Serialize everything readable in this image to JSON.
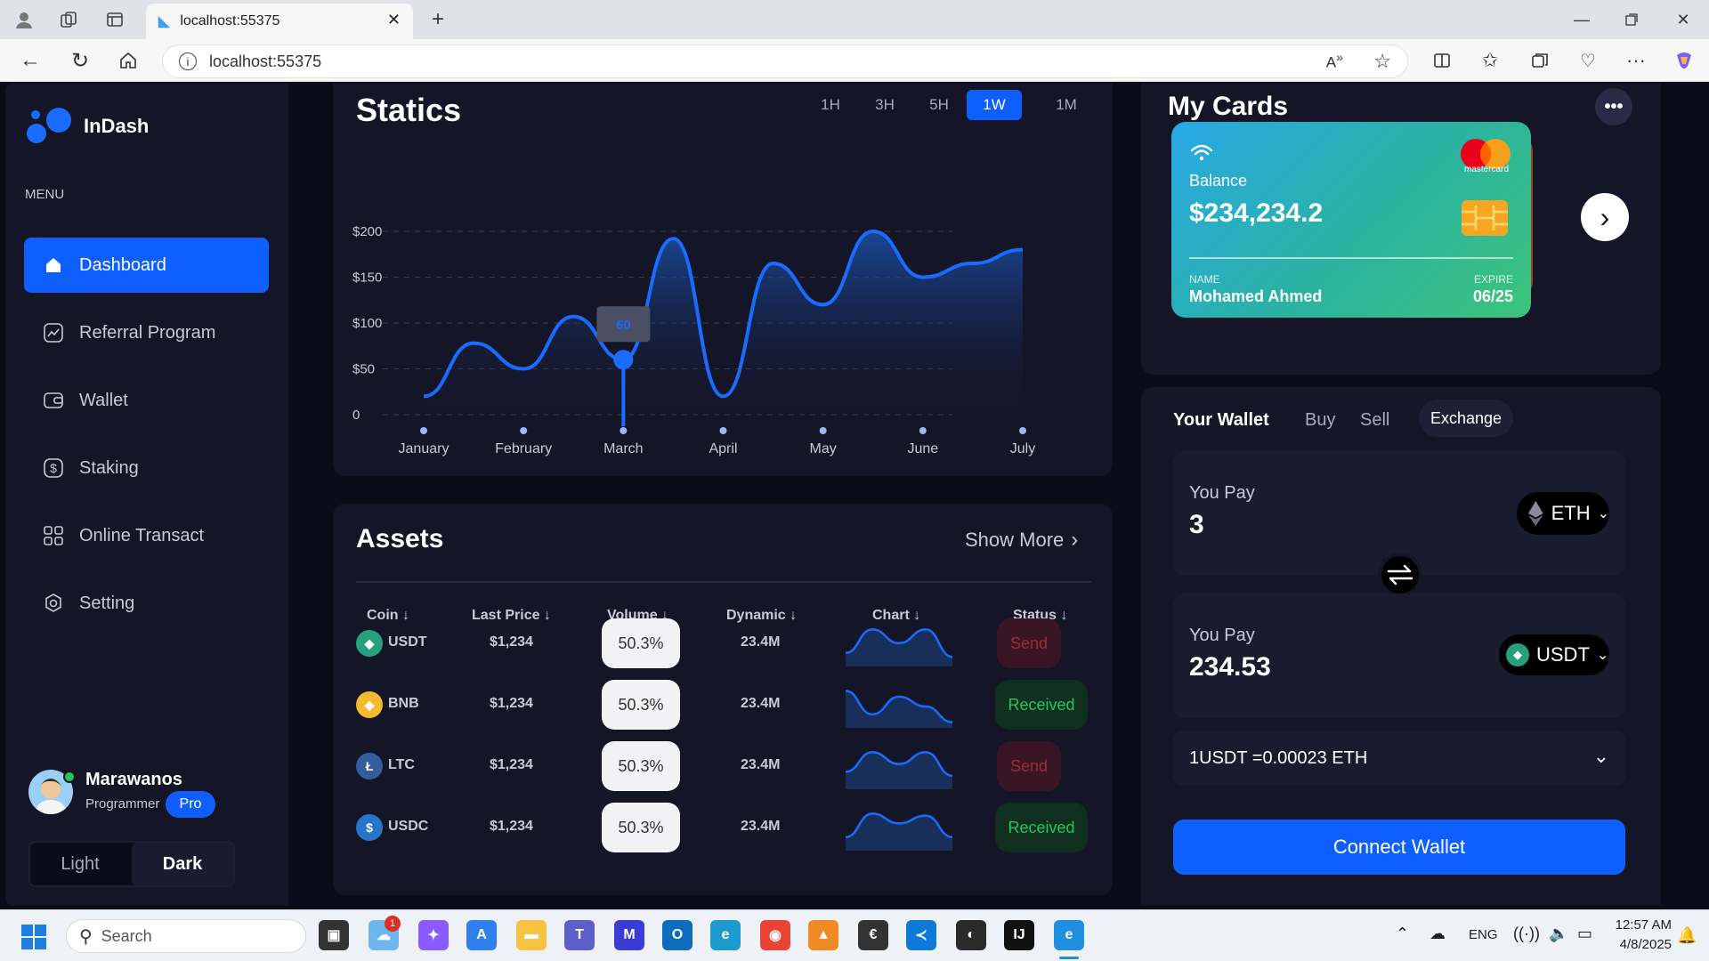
{
  "browser": {
    "tab_title": "localhost:55375",
    "address": "localhost:55375"
  },
  "brand": {
    "name": "InDash"
  },
  "sidebar": {
    "menu_label": "MENU",
    "items": [
      {
        "label": "Dashboard",
        "icon": "home-icon",
        "active": true
      },
      {
        "label": "Referral Program",
        "icon": "chart-line-icon",
        "active": false
      },
      {
        "label": "Wallet",
        "icon": "wallet-icon",
        "active": false
      },
      {
        "label": "Staking",
        "icon": "dollar-icon",
        "active": false
      },
      {
        "label": "Online Transact",
        "icon": "grid-icon",
        "active": false
      },
      {
        "label": "Setting",
        "icon": "settings-icon",
        "active": false
      }
    ],
    "user": {
      "name": "Marawanos",
      "role": "Programmer",
      "badge": "Pro"
    },
    "theme": {
      "light": "Light",
      "dark": "Dark",
      "selected": "Dark"
    }
  },
  "statics": {
    "title": "Statics",
    "timeframes": [
      "1H",
      "3H",
      "5H",
      "1W",
      "1M"
    ],
    "active_timeframe": "1W",
    "tooltip_value": "60"
  },
  "chart_data": {
    "type": "area",
    "x_ticks": [
      "January",
      "February",
      "March",
      "April",
      "May",
      "June",
      "July"
    ],
    "y_ticks": [
      "$200",
      "$150",
      "$100",
      "$50",
      "0"
    ],
    "ylim": [
      0,
      200
    ],
    "x": [
      0,
      0.5,
      1,
      1.5,
      2,
      2.5,
      3,
      3.5,
      4,
      4.5,
      5,
      5.5,
      6
    ],
    "y": [
      20,
      78,
      50,
      107,
      60,
      192,
      20,
      165,
      120,
      200,
      150,
      165,
      180
    ],
    "highlight": {
      "category": "March",
      "value": 60
    },
    "grid": true,
    "color": "#1a6bff"
  },
  "assets": {
    "title": "Assets",
    "show_more": "Show More",
    "columns": [
      "Coin",
      "Last Price",
      "Volume",
      "Dynamic",
      "Chart",
      "Status"
    ],
    "rows": [
      {
        "coin": "USDT",
        "price": "$1,234",
        "volume": "50.3%",
        "dynamic": "23.4M",
        "status": "Send",
        "icon_color": "#26a17b",
        "icon_glyph": "◆",
        "spark": [
          0.3,
          0.9,
          0.55,
          0.9,
          0.2
        ]
      },
      {
        "coin": "BNB",
        "price": "$1,234",
        "volume": "50.3%",
        "dynamic": "23.4M",
        "status": "Received",
        "icon_color": "#f3ba2f",
        "icon_glyph": "◈",
        "spark": [
          0.9,
          0.3,
          0.75,
          0.5,
          0.1
        ]
      },
      {
        "coin": "LTC",
        "price": "$1,234",
        "volume": "50.3%",
        "dynamic": "23.4M",
        "status": "Send",
        "icon_color": "#345d9d",
        "icon_glyph": "Ł",
        "spark": [
          0.4,
          0.9,
          0.6,
          0.9,
          0.3
        ]
      },
      {
        "coin": "USDC",
        "price": "$1,234",
        "volume": "50.3%",
        "dynamic": "23.4M",
        "status": "Received",
        "icon_color": "#2775ca",
        "icon_glyph": "$",
        "spark": [
          0.3,
          0.9,
          0.65,
          0.85,
          0.3
        ]
      }
    ]
  },
  "cards": {
    "title": "My Cards",
    "balance_label": "Balance",
    "balance": "$234,234.2",
    "brand": "mastercard",
    "name_label": "NAME",
    "name": "Mohamed Ahmed",
    "expire_label": "EXPIRE",
    "expire": "06/25"
  },
  "wallet": {
    "tabs": [
      "Your Wallet",
      "Buy",
      "Sell",
      "Exchange"
    ],
    "active_tab": "Exchange",
    "pay1_label": "You Pay",
    "pay1_value": "3",
    "pay1_coin": "ETH",
    "pay2_label": "You Pay",
    "pay2_value": "234.53",
    "pay2_coin": "USDT",
    "rate": "1USDT =0.00023 ETH",
    "connect_button": "Connect Wallet"
  },
  "taskbar": {
    "search_placeholder": "Search",
    "notification_count": "1",
    "lang": "ENG",
    "time": "12:57 AM",
    "date": "4/8/2025"
  }
}
